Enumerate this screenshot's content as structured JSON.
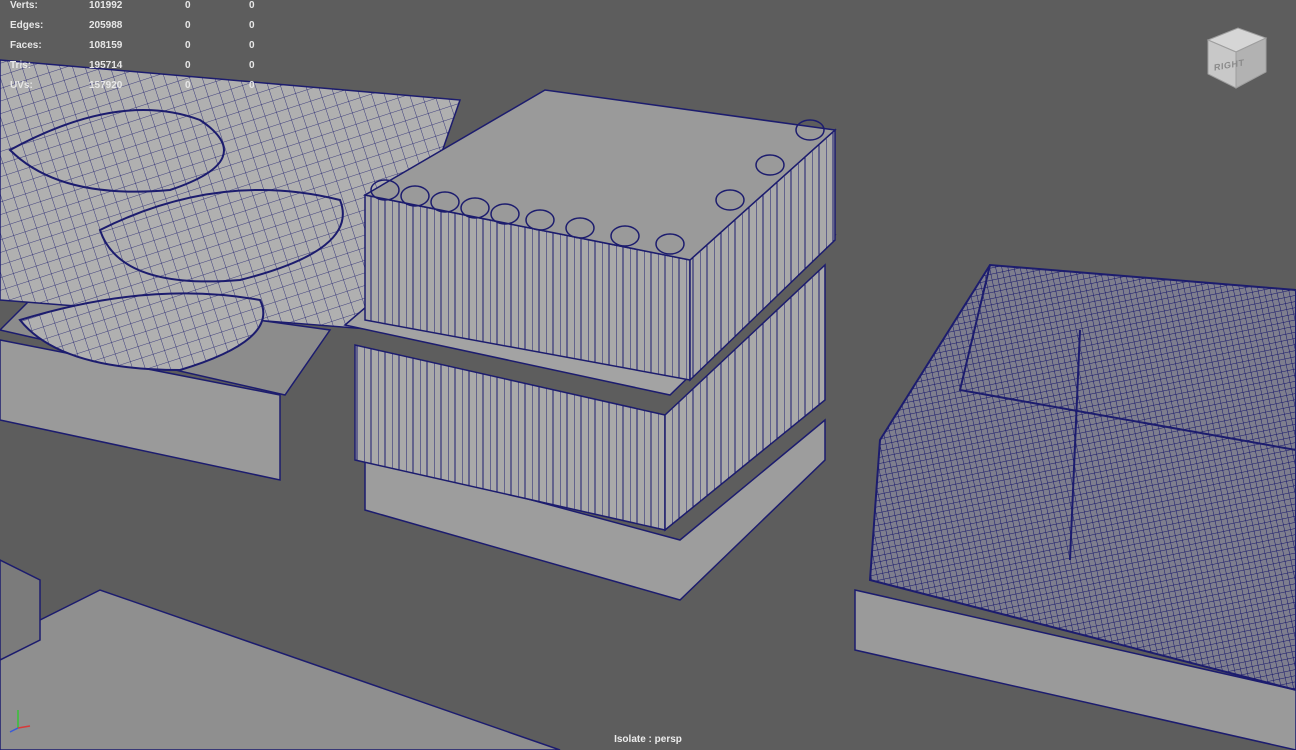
{
  "heads_up": {
    "rows": [
      {
        "label": "Verts:",
        "count": "101992",
        "sel1": "0",
        "sel2": "0"
      },
      {
        "label": "Edges:",
        "count": "205988",
        "sel1": "0",
        "sel2": "0"
      },
      {
        "label": "Faces:",
        "count": "108159",
        "sel1": "0",
        "sel2": "0"
      },
      {
        "label": "Tris:",
        "count": "195714",
        "sel1": "0",
        "sel2": "0"
      },
      {
        "label": "UVs:",
        "count": "157920",
        "sel1": "0",
        "sel2": "0"
      }
    ]
  },
  "viewcube": {
    "face_label": "RIGHT"
  },
  "viewport": {
    "caption": "Isolate : persp"
  },
  "colors": {
    "background": "#5d5d5d",
    "wireframe": "#1e1e7a",
    "shaded_mesh": "#9a9a9a",
    "hud_text": "#e8e8e8"
  },
  "icons": {
    "view_axis": "axis-gizmo-icon",
    "view_cube": "view-cube-icon"
  }
}
